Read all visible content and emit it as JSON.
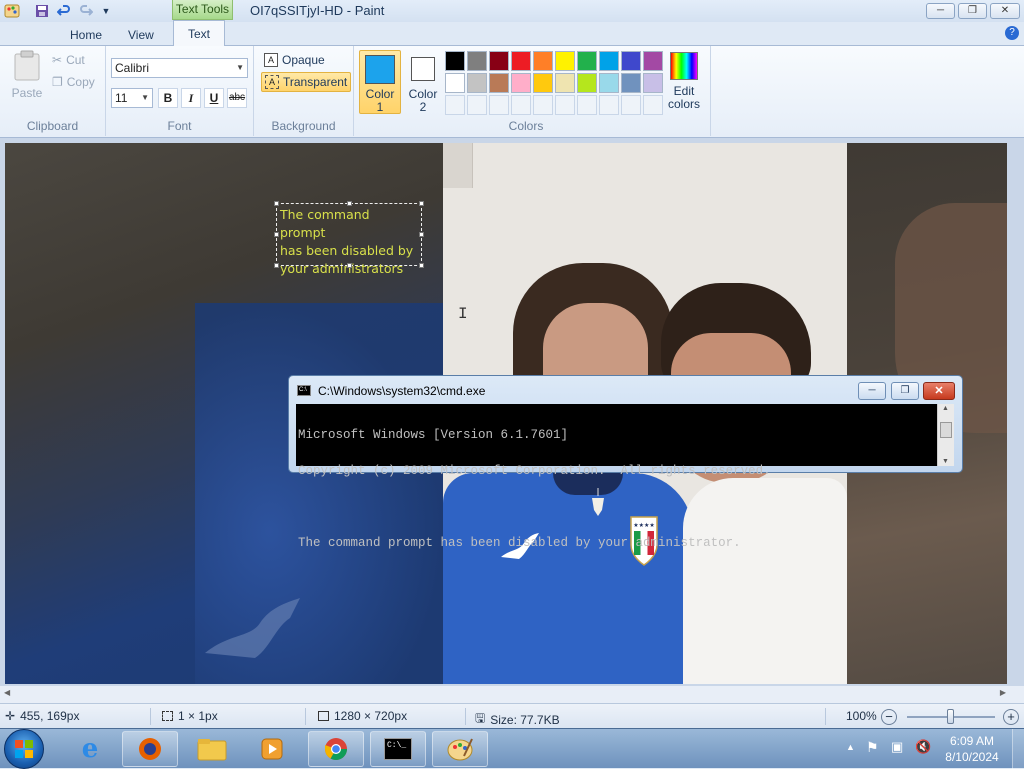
{
  "window": {
    "title": "OI7qSSITjyI-HD - Paint",
    "contextual_tab": "Text Tools",
    "minimize_label": "─",
    "restore_label": "❐",
    "close_label": "✕"
  },
  "tabs": [
    {
      "label": "Home"
    },
    {
      "label": "View"
    },
    {
      "label": "Text"
    }
  ],
  "clipboard": {
    "group_label": "Clipboard",
    "paste_label": "Paste",
    "cut_label": "Cut",
    "copy_label": "Copy"
  },
  "font": {
    "group_label": "Font",
    "family_value": "Calibri",
    "size_value": "11",
    "bold_label": "B",
    "italic_label": "I",
    "underline_label": "U",
    "strike_label": "abc"
  },
  "background": {
    "group_label": "Background",
    "opaque_label": "Opaque",
    "transparent_label": "Transparent",
    "selected": "Transparent"
  },
  "colors": {
    "group_label": "Colors",
    "color1_label": "Color",
    "color1_num": "1",
    "color2_label": "Color",
    "color2_num": "2",
    "color1_value": "#1ca3ec",
    "color2_value": "#ffffff",
    "edit_label": "Edit",
    "edit_label2": "colors",
    "palette_row1": [
      "#000000",
      "#7f7f7f",
      "#880015",
      "#ed1c24",
      "#ff7f27",
      "#fff200",
      "#22b14c",
      "#00a2e8",
      "#3f48cc",
      "#a349a4"
    ],
    "palette_row2": [
      "#ffffff",
      "#c3c3c3",
      "#b97a57",
      "#ffaec9",
      "#ffc90e",
      "#efe4b0",
      "#b5e61d",
      "#99d9ea",
      "#7092be",
      "#c8bfe7"
    ]
  },
  "canvas": {
    "text_box_line1": "The command prompt",
    "text_box_line2": "has been disabled by",
    "text_box_line3": "your administrators",
    "text_color": "#d8e04a"
  },
  "cmd": {
    "title": "C:\\Windows\\system32\\cmd.exe",
    "line1": "Microsoft Windows [Version 6.1.7601]",
    "line2": "Copyright (c) 2009 Microsoft Corporation.  All rights reserved.",
    "line3": "",
    "line4": "The command prompt has been disabled by your administrator."
  },
  "status": {
    "cursor_pos": "455, 169px",
    "selection_size": "1 × 1px",
    "image_size": "1280 × 720px",
    "file_size": "Size: 77.7KB",
    "zoom": "100%",
    "zoom_level": 0.5
  },
  "taskbar": {
    "time": "6:09 AM",
    "date": "8/10/2024"
  }
}
